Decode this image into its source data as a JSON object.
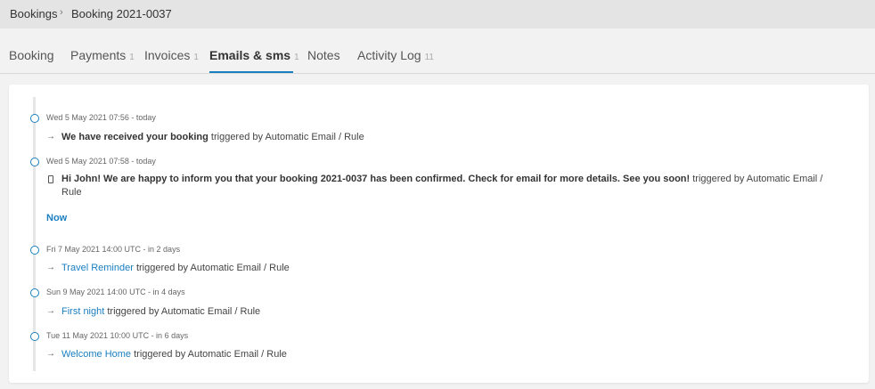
{
  "breadcrumb": {
    "root": "Bookings",
    "current": "Booking 2021-0037"
  },
  "tabs": [
    {
      "label": "Booking",
      "count": ""
    },
    {
      "label": "Payments",
      "count": "1"
    },
    {
      "label": "Invoices",
      "count": "1"
    },
    {
      "label": "Emails & sms",
      "count": "1"
    },
    {
      "label": "Notes",
      "count": ""
    },
    {
      "label": "Activity Log",
      "count": "11"
    }
  ],
  "timeline": {
    "now_label": "Now",
    "entries": [
      {
        "timestamp": "Wed 5 May 2021 07:56 - today",
        "subject": "We have received your booking",
        "suffix": " triggered by Automatic Email / Rule",
        "channel": "arrow-icon"
      },
      {
        "timestamp": "Wed 5 May 2021 07:58 - today",
        "subject": "Hi John! We are happy to inform you that your booking 2021-0037 has been confirmed. Check for email for more details. See you soon!",
        "suffix": " triggered by Automatic Email / Rule",
        "channel": "phone-icon"
      },
      {
        "timestamp": "Fri 7 May 2021 14:00 UTC - in 2 days",
        "subject": "Travel Reminder",
        "suffix": " triggered by Automatic Email / Rule",
        "channel": "arrow-icon"
      },
      {
        "timestamp": "Sun 9 May 2021 14:00 UTC - in 4 days",
        "subject": "First night",
        "suffix": " triggered by Automatic Email / Rule",
        "channel": "arrow-icon"
      },
      {
        "timestamp": "Tue 11 May 2021 10:00 UTC - in 6 days",
        "subject": "Welcome Home",
        "suffix": " triggered by Automatic Email / Rule",
        "channel": "arrow-icon"
      }
    ]
  },
  "colors": {
    "accent": "#1a7fc1",
    "header_bg": "#e4e4e4",
    "page_bg": "#f2f2f2"
  }
}
